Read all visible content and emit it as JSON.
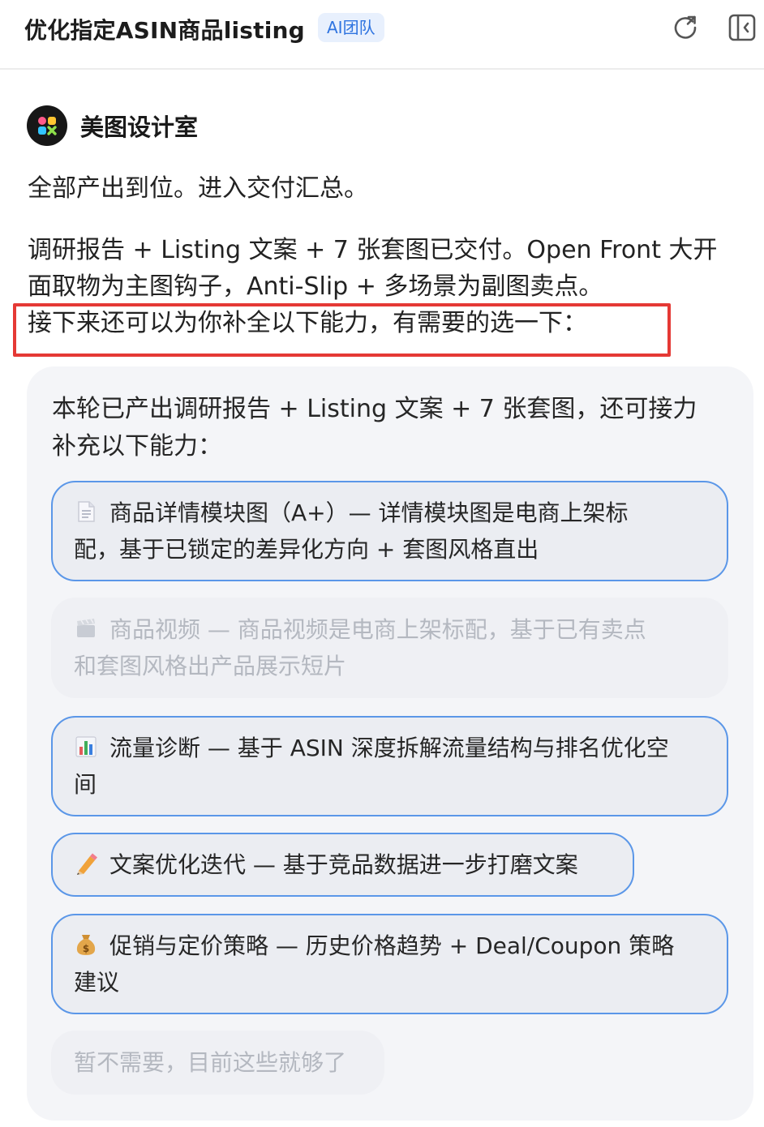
{
  "header": {
    "title": "优化指定ASIN商品listing",
    "badge": "AI团队",
    "icons": [
      "refresh-icon",
      "collapse-panel-icon"
    ]
  },
  "agent": {
    "name": "美图设计室",
    "avatar_icon": "meitu-logo-icon"
  },
  "message": {
    "line1": "全部产出到位。进入交付汇总。",
    "line2": "调研报告 + Listing 文案 + 7 张套图已交付。Open Front 大开",
    "line3": "面取物为主图钩子，Anti-Slip + 多场景为副图卖点。",
    "line4": "接下来还可以为你补全以下能力，有需要的选一下："
  },
  "panel": {
    "intro_line1": "本轮已产出调研报告 + Listing 文案 + 7 张套图，还可接力",
    "intro_line2": "补充以下能力：",
    "options": [
      {
        "icon": "document-icon",
        "line1": "商品详情模块图（A+）— 详情模块图是电商上架标",
        "line2": "配，基于已锁定的差异化方向 + 套图风格直出",
        "enabled": true
      },
      {
        "icon": "clapperboard-icon",
        "line1": "商品视频 — 商品视频是电商上架标配，基于已有卖点",
        "line2": "和套图风格出产品展示短片",
        "enabled": false
      },
      {
        "icon": "bar-chart-icon",
        "line1": "流量诊断 — 基于 ASIN 深度拆解流量结构与排名优化空",
        "line2": "间",
        "enabled": true
      },
      {
        "icon": "pencil-icon",
        "line1": "文案优化迭代 — 基于竞品数据进一步打磨文案",
        "enabled": true
      },
      {
        "icon": "money-bag-icon",
        "line1": "促销与定价策略 — 历史价格趋势 + Deal/Coupon 策略",
        "line2": "建议",
        "enabled": true
      },
      {
        "line1": "暂不需要，目前这些就够了",
        "enabled": false
      }
    ]
  },
  "colors": {
    "accent": "#5b97e8",
    "badge_bg": "#e8f0fd",
    "badge_text": "#2f74e0",
    "highlight": "#e53935",
    "panel_bg": "#f4f5f8"
  }
}
